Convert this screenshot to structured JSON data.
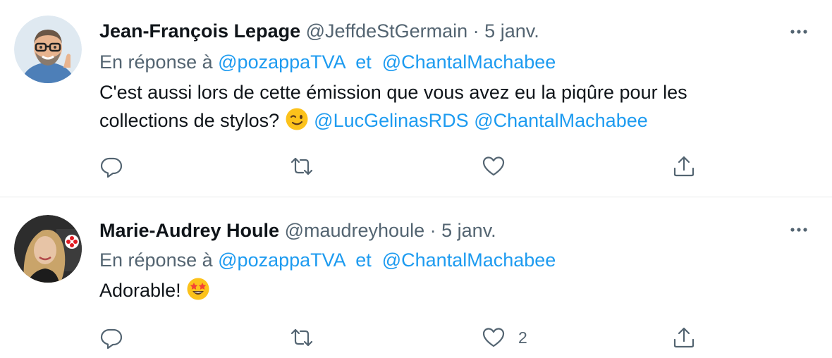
{
  "tweets": [
    {
      "author_name": "Jean-François Lepage",
      "author_handle": "@JeffdeStGermain",
      "separator": "·",
      "date": "5 janv.",
      "reply_prefix": "En réponse à",
      "reply_to": [
        "@pozappaTVA",
        "@ChantalMachabee"
      ],
      "reply_joiner": "et",
      "text_line1": "C'est aussi lors de cette émission que vous avez eu la piqûre pour les",
      "text_line2": "collections de stylos?",
      "emoji": "winking-face",
      "mentions": [
        "@LucGelinasRDS",
        "@ChantalMachabee"
      ],
      "like_count": ""
    },
    {
      "author_name": "Marie-Audrey Houle",
      "author_handle": "@maudreyhoule",
      "separator": "·",
      "date": "5 janv.",
      "reply_prefix": "En réponse à",
      "reply_to": [
        "@pozappaTVA",
        "@ChantalMachabee"
      ],
      "reply_joiner": "et",
      "text": "Adorable!",
      "emoji": "star-struck-face",
      "like_count": "2"
    }
  ],
  "icons": {
    "reply": "speech-bubble",
    "retweet": "retweet-arrows",
    "like": "heart",
    "share": "share-upload",
    "more": "three-dots"
  },
  "colors": {
    "link": "#1d9bf0",
    "secondary_text": "#536471",
    "primary_text": "#0f1419",
    "divider": "#e7e9ea"
  }
}
